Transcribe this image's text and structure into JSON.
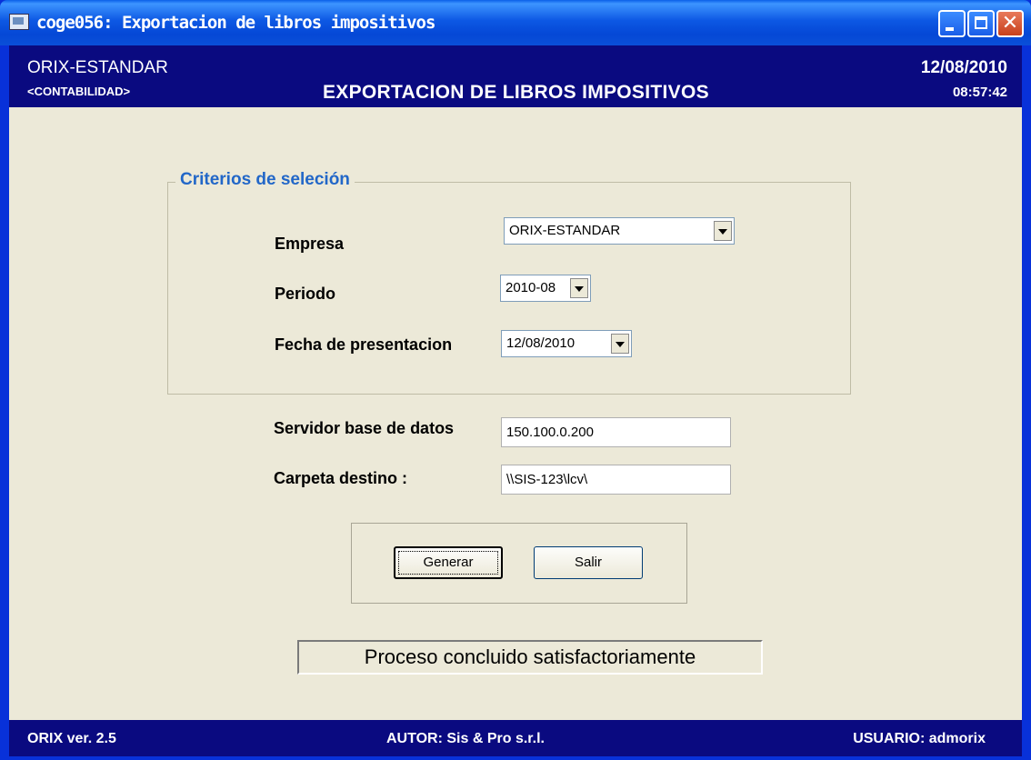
{
  "window": {
    "title": "coge056: Exportacion de libros impositivos"
  },
  "header": {
    "company": "ORIX-ESTANDAR",
    "module": "<CONTABILIDAD>",
    "title": "EXPORTACION DE LIBROS IMPOSITIVOS",
    "date": "12/08/2010",
    "time": "08:57:42"
  },
  "criteria": {
    "legend": "Criterios de seleción",
    "empresa_label": "Empresa",
    "empresa_value": "ORIX-ESTANDAR",
    "periodo_label": "Periodo",
    "periodo_value": "2010-08",
    "fecha_label": "Fecha de presentacion",
    "fecha_value": "12/08/2010"
  },
  "fields": {
    "servidor_label": "Servidor base de datos",
    "servidor_value": "150.100.0.200",
    "carpeta_label": "Carpeta destino :",
    "carpeta_value": "\\\\SIS-123\\lcv\\"
  },
  "buttons": {
    "generar": "Generar",
    "salir": "Salir"
  },
  "status": "Proceso concluido satisfactoriamente",
  "footer": {
    "version": "ORIX ver. 2.5",
    "author": "AUTOR: Sis & Pro s.r.l.",
    "user": "USUARIO: admorix"
  },
  "colors": {
    "titlebar": "#0548d6",
    "header_bg": "#0a0a80",
    "dialog_bg": "#ece9d8",
    "legend": "#2267c8"
  },
  "icons": [
    "app-window-icon",
    "minimize-icon",
    "maximize-icon",
    "close-icon",
    "dropdown-arrow-icon"
  ]
}
